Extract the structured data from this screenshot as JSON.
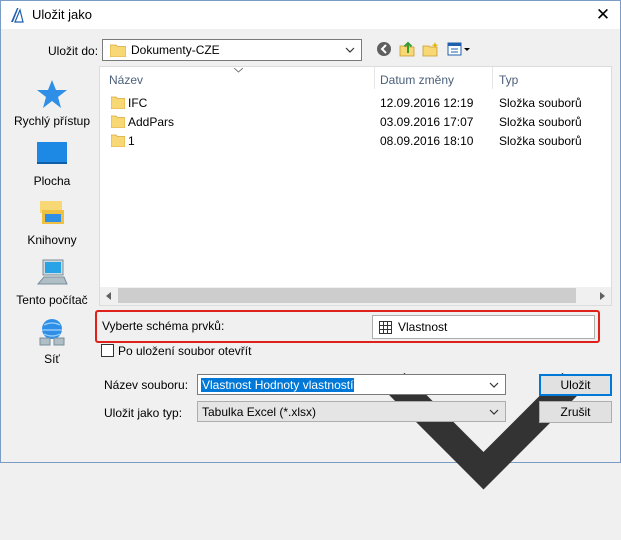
{
  "window": {
    "title": "Uložit jako",
    "close_glyph": "✕"
  },
  "toolbar": {
    "save_in_label": "Uložit do:",
    "save_in_value": "Dokumenty-CZE"
  },
  "places": [
    {
      "label": "Rychlý přístup",
      "icon": "star-icon"
    },
    {
      "label": "Plocha",
      "icon": "desktop-icon"
    },
    {
      "label": "Knihovny",
      "icon": "libraries-icon"
    },
    {
      "label": "Tento počítač",
      "icon": "computer-icon"
    },
    {
      "label": "Síť",
      "icon": "network-icon"
    }
  ],
  "file_list": {
    "columns": [
      "Název",
      "Datum změny",
      "Typ"
    ],
    "rows": [
      {
        "name": "IFC",
        "date": "12.09.2016 12:19",
        "type": "Složka souborů"
      },
      {
        "name": "AddPars",
        "date": "03.09.2016 17:07",
        "type": "Složka souborů"
      },
      {
        "name": "1",
        "date": "08.09.2016 18:10",
        "type": "Složka souborů"
      }
    ]
  },
  "scheme": {
    "label": "Vyberte schéma prvků:",
    "value": "Vlastnost"
  },
  "open_after_save": {
    "label": "Po uložení soubor otevřít",
    "checked": false
  },
  "filename": {
    "label": "Název souboru:",
    "value": "Vlastnost Hodnoty vlastností"
  },
  "filetype": {
    "label": "Uložit jako typ:",
    "value": "Tabulka Excel (*.xlsx)"
  },
  "buttons": {
    "save": "Uložit",
    "cancel": "Zrušit"
  },
  "colors": {
    "accent": "#0078d7",
    "highlight_border": "#e0211b",
    "folder": "#f8d775"
  }
}
